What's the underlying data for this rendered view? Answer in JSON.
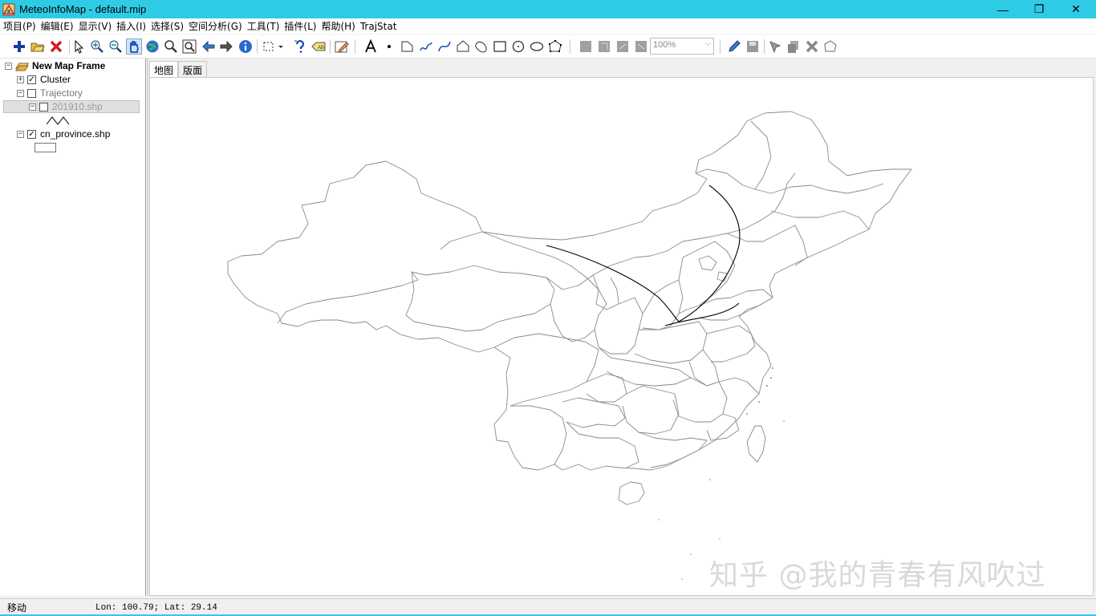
{
  "window": {
    "title": "MeteoInfoMap - default.mip",
    "minimize_glyph": "—",
    "restore_glyph": "❐",
    "close_glyph": "✕"
  },
  "menu": {
    "items": [
      "项目(P)",
      "编辑(E)",
      "显示(V)",
      "插入(I)",
      "选择(S)",
      "空间分析(G)",
      "工具(T)",
      "插件(L)",
      "帮助(H)",
      "TrajStat"
    ]
  },
  "toolbar": {
    "zoom_value": "100%",
    "zoom_arrow": "⌵"
  },
  "legend": {
    "root": {
      "label": "New Map Frame",
      "expander": "−"
    },
    "layers": [
      {
        "label": "Cluster",
        "expander": "+",
        "checked": "✓"
      },
      {
        "label": "Trajectory",
        "expander": "−",
        "checked": ""
      },
      {
        "label": "201910.shp",
        "expander": "−",
        "checked": ""
      },
      {
        "label": "cn_province.shp",
        "expander": "−",
        "checked": "✓"
      }
    ]
  },
  "tabs": [
    "地图",
    "版面"
  ],
  "watermark": "知乎 @我的青春有风吹过",
  "status": {
    "mode": "移动",
    "coords": "Lon: 100.79; Lat: 29.14"
  },
  "colors": {
    "titlebar": "#2fcbe6",
    "map_outline": "#8a8a8a",
    "trajectory": "#000000"
  }
}
